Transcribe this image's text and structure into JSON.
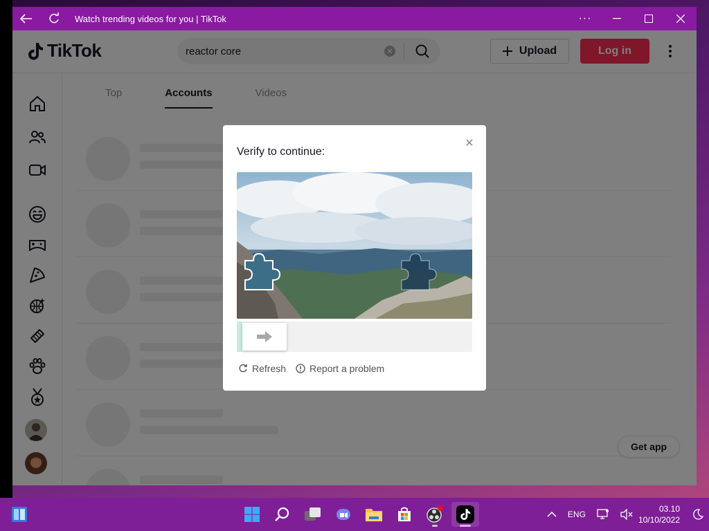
{
  "window": {
    "title": "Watch trending videos for you | TikTok"
  },
  "topbar": {
    "logo_text": "TikTok",
    "search_value": "reactor core",
    "upload_label": "Upload",
    "login_label": "Log in"
  },
  "tabs": [
    {
      "label": "Top",
      "active": false
    },
    {
      "label": "Accounts",
      "active": true
    },
    {
      "label": "Videos",
      "active": false
    }
  ],
  "sidebar": {
    "icons": [
      "home-icon",
      "following-icon",
      "live-icon",
      "comedy-icon",
      "gaming-icon",
      "food-icon",
      "dance-icon",
      "beauty-icon",
      "animals-icon",
      "sports-icon"
    ]
  },
  "getapp_label": "Get app",
  "modal": {
    "title": "Verify to continue:",
    "refresh_label": "Refresh",
    "report_label": "Report a problem"
  },
  "taskbar": {
    "language": "ENG",
    "time": "03.10",
    "date": "10/10/2022"
  },
  "colors": {
    "titlebar": "#8a1aa1",
    "taskbar": "#7e1f97",
    "login": "#fe2c55"
  }
}
